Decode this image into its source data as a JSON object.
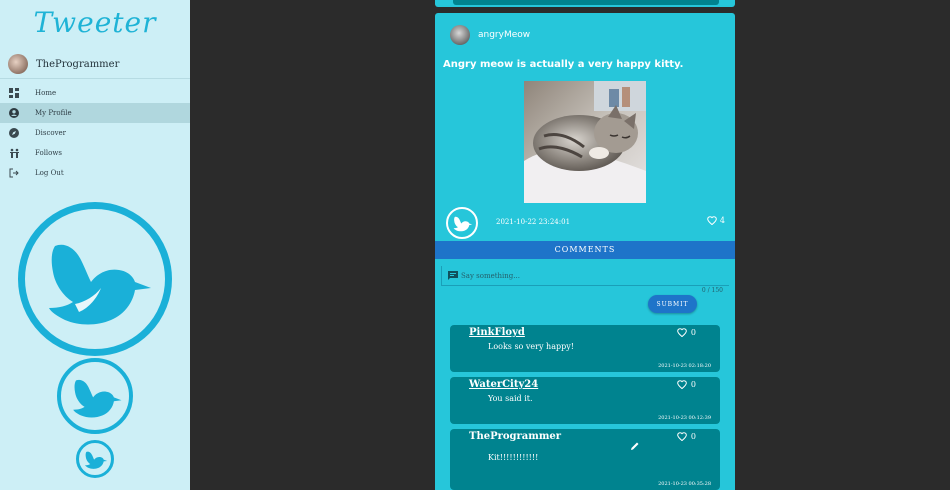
{
  "app": {
    "logo_text": "Tweeter"
  },
  "sidebar": {
    "user_name": "TheProgrammer",
    "items": [
      {
        "label": "Home",
        "icon": "dashboard-icon"
      },
      {
        "label": "My Profile",
        "icon": "account-circle-icon",
        "active": true
      },
      {
        "label": "Discover",
        "icon": "compass-icon"
      },
      {
        "label": "Follows",
        "icon": "people-icon"
      },
      {
        "label": "Log Out",
        "icon": "logout-icon"
      }
    ]
  },
  "post": {
    "author": "angryMeow",
    "text": "Angry meow is actually a very happy kitty.",
    "date": "2021-10-22 23:24:01",
    "likes": "4",
    "comments_label": "COMMENTS"
  },
  "comment_form": {
    "placeholder": "Say something...",
    "counter": "0 / 150",
    "submit_label": "SUBMIT"
  },
  "comments": [
    {
      "user": "PinkFloyd",
      "text": "Looks so very happy!",
      "likes": "0",
      "date": "2021-10-23 02:18:20"
    },
    {
      "user": "WaterCity24",
      "text": "You said it.",
      "likes": "0",
      "date": "2021-10-23 00:12:39"
    },
    {
      "user": "TheProgrammer",
      "text": "Kit!!!!!!!!!!!!",
      "likes": "0",
      "date": "2021-10-23 00:35:28"
    }
  ],
  "colors": {
    "accent": "#1ab0d8",
    "card": "#26c6da",
    "comment_bg": "#00838f",
    "button": "#1e74c9",
    "sidebar_bg": "#cdeff6"
  }
}
